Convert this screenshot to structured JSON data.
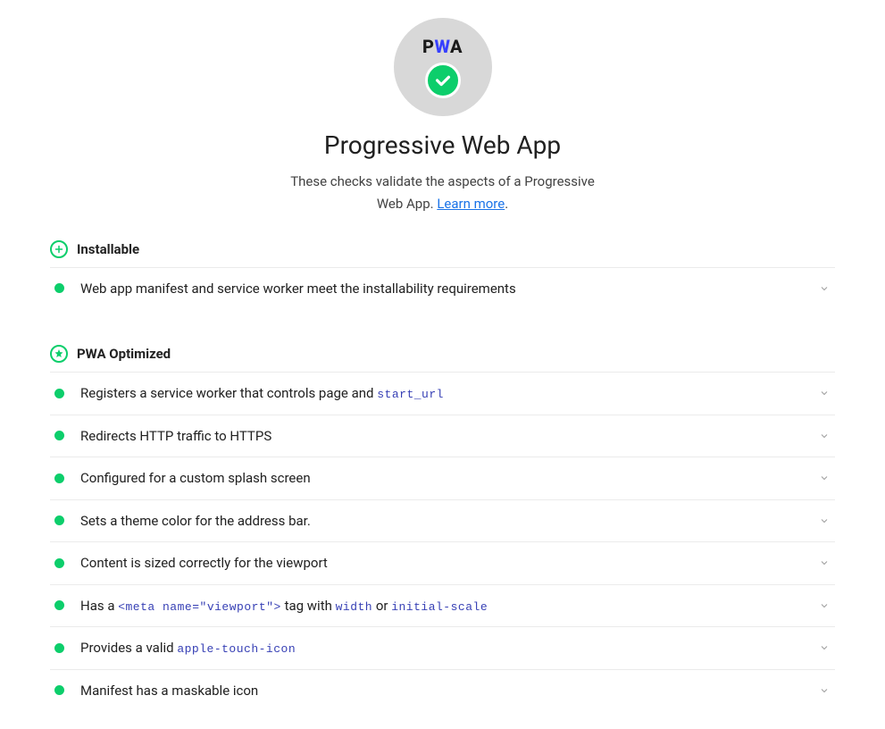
{
  "header": {
    "pwa_logo_text": "PWA",
    "title": "Progressive Web App",
    "subtitle_prefix": "These checks validate the aspects of a Progressive Web App. ",
    "learn_more": "Learn more",
    "subtitle_suffix": "."
  },
  "sections": {
    "installable": {
      "title": "Installable",
      "icon": "plus-circle",
      "audits": [
        {
          "text": "Web app manifest and service worker meet the installability requirements",
          "codes": []
        }
      ]
    },
    "optimized": {
      "title": "PWA Optimized",
      "icon": "star-circle",
      "audits": [
        {
          "text": "Registers a service worker that controls page and ",
          "codes": [
            "start_url"
          ]
        },
        {
          "text": "Redirects HTTP traffic to HTTPS",
          "codes": []
        },
        {
          "text": "Configured for a custom splash screen",
          "codes": []
        },
        {
          "text": "Sets a theme color for the address bar.",
          "codes": []
        },
        {
          "text": "Content is sized correctly for the viewport",
          "codes": []
        },
        {
          "text_pre": "Has a ",
          "codes": [
            "<meta name=\"viewport\">"
          ],
          "text_mid": " tag with ",
          "codes2": [
            "width"
          ],
          "text_mid2": " or ",
          "codes3": [
            "initial-scale"
          ]
        },
        {
          "text": "Provides a valid ",
          "codes": [
            "apple-touch-icon"
          ]
        },
        {
          "text": "Manifest has a maskable icon",
          "codes": []
        }
      ]
    }
  },
  "colors": {
    "pass": "#0cce6b",
    "link": "#1a73e8",
    "code": "#3740b5"
  }
}
